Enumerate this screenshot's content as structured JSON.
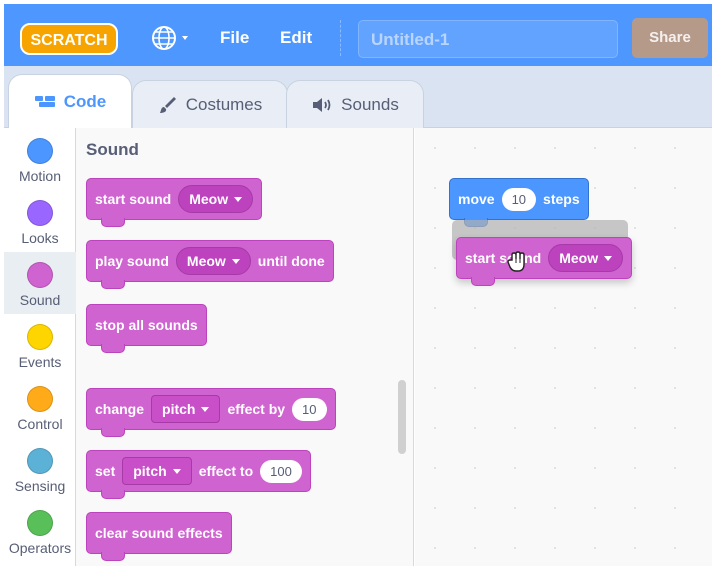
{
  "menubar": {
    "logo_text": "SCRATCH",
    "file_label": "File",
    "edit_label": "Edit",
    "project_title": "Untitled-1",
    "share_label": "Share",
    "globe_icon": "globe-icon"
  },
  "tabs": [
    {
      "label": "Code",
      "icon": "code-icon",
      "active": true
    },
    {
      "label": "Costumes",
      "icon": "brush-icon",
      "active": false
    },
    {
      "label": "Sounds",
      "icon": "speaker-icon",
      "active": false
    }
  ],
  "categories": [
    {
      "label": "Motion",
      "color": "#4c97ff"
    },
    {
      "label": "Looks",
      "color": "#9966ff"
    },
    {
      "label": "Sound",
      "color": "#cf63cf",
      "selected": true
    },
    {
      "label": "Events",
      "color": "#ffd500"
    },
    {
      "label": "Control",
      "color": "#ffab19"
    },
    {
      "label": "Sensing",
      "color": "#5cb1d6"
    },
    {
      "label": "Operators",
      "color": "#59c059"
    }
  ],
  "flyout": {
    "title": "Sound",
    "blocks": {
      "start_sound": {
        "label": "start sound",
        "sound": "Meow"
      },
      "play_sound": {
        "label": "play sound",
        "sound": "Meow",
        "suffix": "until done"
      },
      "stop_all": {
        "label": "stop all sounds"
      },
      "change_effect": {
        "label": "change",
        "effect": "pitch",
        "mid": "effect by",
        "value": "10"
      },
      "set_effect": {
        "label": "set",
        "effect": "pitch",
        "mid": "effect to",
        "value": "100"
      },
      "clear_effects": {
        "label": "clear sound effects"
      }
    }
  },
  "workspace": {
    "move_block": {
      "label": "move",
      "value": "10",
      "suffix": "steps"
    },
    "dragged_block": {
      "label": "start sound",
      "sound": "Meow"
    },
    "cursor_icon": "grab-hand-icon"
  },
  "colors": {
    "menubar": "#4d97ff",
    "sound": "#cf63cf",
    "motion": "#4c97ff"
  }
}
